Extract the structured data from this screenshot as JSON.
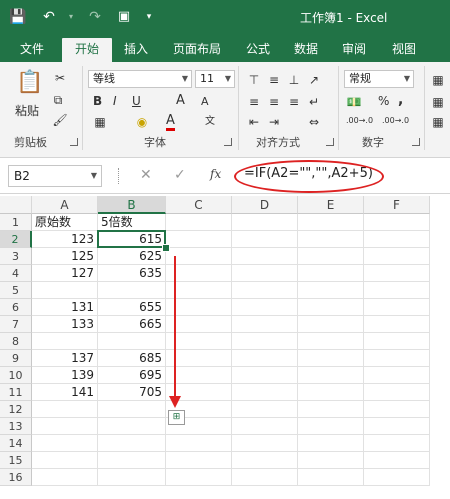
{
  "window": {
    "title": "工作簿1 - Excel"
  },
  "tabs": [
    "文件",
    "开始",
    "插入",
    "页面布局",
    "公式",
    "数据",
    "审阅",
    "视图"
  ],
  "ribbon": {
    "paste_label": "粘贴",
    "font_name": "等线",
    "font_size": "11",
    "number_format": "常规",
    "groups": {
      "clipboard": "剪贴板",
      "font": "字体",
      "alignment": "对齐方式",
      "number": "数字"
    },
    "bold": "B",
    "italic": "I",
    "underline": "U",
    "grow_font": "A",
    "shrink_font": "A",
    "font_color": "A",
    "percent": "%",
    "comma": ",",
    "inc_decimal": ".00→.0",
    "dec_decimal": ".00→.0"
  },
  "formula_bar": {
    "name_box": "B2",
    "fx": "fx",
    "formula": "=IF(A2=\"\",\"\",A2+5)"
  },
  "grid": {
    "columns": [
      "A",
      "B",
      "C",
      "D",
      "E",
      "F"
    ],
    "rows": [
      "1",
      "2",
      "3",
      "4",
      "5",
      "6",
      "7",
      "8",
      "9",
      "10",
      "11",
      "12",
      "13",
      "14",
      "15",
      "16"
    ],
    "cells_A": [
      "原始数",
      "123",
      "125",
      "127",
      "",
      "131",
      "133",
      "",
      "137",
      "139",
      "141",
      "",
      "",
      "",
      "",
      ""
    ],
    "cells_B": [
      "5倍数",
      "615",
      "625",
      "635",
      "",
      "655",
      "665",
      "",
      "685",
      "695",
      "705",
      "",
      "",
      "",
      "",
      ""
    ],
    "selected_cell": "B2"
  },
  "colors": {
    "brand": "#217346",
    "annotation": "#dd2222"
  },
  "icons": [
    "save-icon",
    "undo-icon",
    "redo-icon",
    "print-preview-icon",
    "paste-icon",
    "cut-icon",
    "copy-icon",
    "format-painter-icon",
    "fill-down-arrow-annotation",
    "autofill-options-icon"
  ]
}
